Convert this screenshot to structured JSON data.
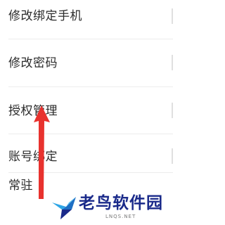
{
  "settings": {
    "items": [
      {
        "label": "修改绑定手机"
      },
      {
        "label": "修改密码"
      },
      {
        "label": "授权管理"
      },
      {
        "label": "账号绑定"
      },
      {
        "label": "常驻"
      }
    ]
  },
  "watermark": {
    "name": "老鸟软件园",
    "domain": "LNQS.NET"
  },
  "colors": {
    "text": "#2b2b2b",
    "divider": "#ececec",
    "annotation_arrow": "#e8322e",
    "watermark_text": "#1a2a8a"
  },
  "icons": {
    "annotation": "red-up-arrow-icon",
    "watermark": "bird-logo-icon"
  }
}
